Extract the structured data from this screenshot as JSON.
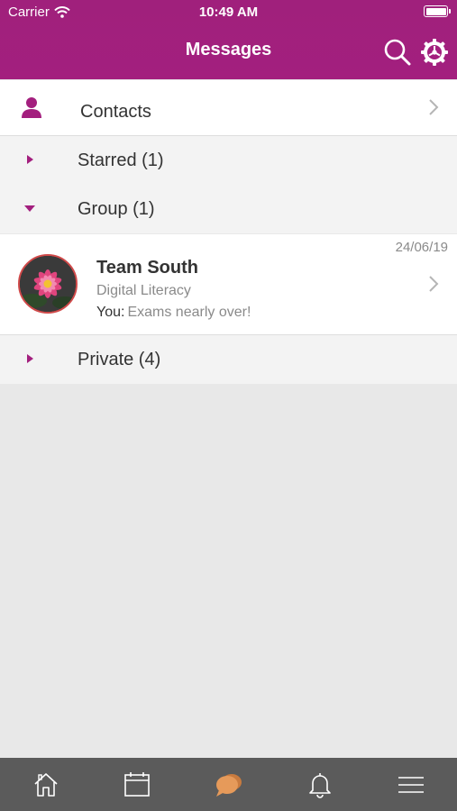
{
  "status_bar": {
    "carrier": "Carrier",
    "time": "10:49 AM"
  },
  "header": {
    "title": "Messages",
    "icons": [
      "search-icon",
      "settings-icon"
    ]
  },
  "contacts": {
    "label": "Contacts",
    "icon": "person-icon"
  },
  "sections": {
    "starred": {
      "label": "Starred (1)",
      "expanded": false
    },
    "group": {
      "label": "Group (1)",
      "expanded": true
    },
    "private": {
      "label": "Private (4)",
      "expanded": false
    }
  },
  "thread": {
    "date": "24/06/19",
    "name": "Team South",
    "subtitle": "Digital Literacy",
    "sender": "You:",
    "preview": "Exams nearly over!",
    "avatar": "water-lily-photo"
  },
  "tabbar": {
    "items": [
      {
        "icon": "home-icon",
        "active": false
      },
      {
        "icon": "calendar-icon",
        "active": false
      },
      {
        "icon": "chat-bubbles-icon",
        "active": true
      },
      {
        "icon": "bell-icon",
        "active": false
      },
      {
        "icon": "menu-icon",
        "active": false
      }
    ]
  },
  "colors": {
    "brand": "#a31f7e",
    "accent_tab": "#e69a5a",
    "tabbar": "#5b5b5b",
    "section_bg": "#f3f3f3",
    "page_bg": "#e8e8e8"
  }
}
